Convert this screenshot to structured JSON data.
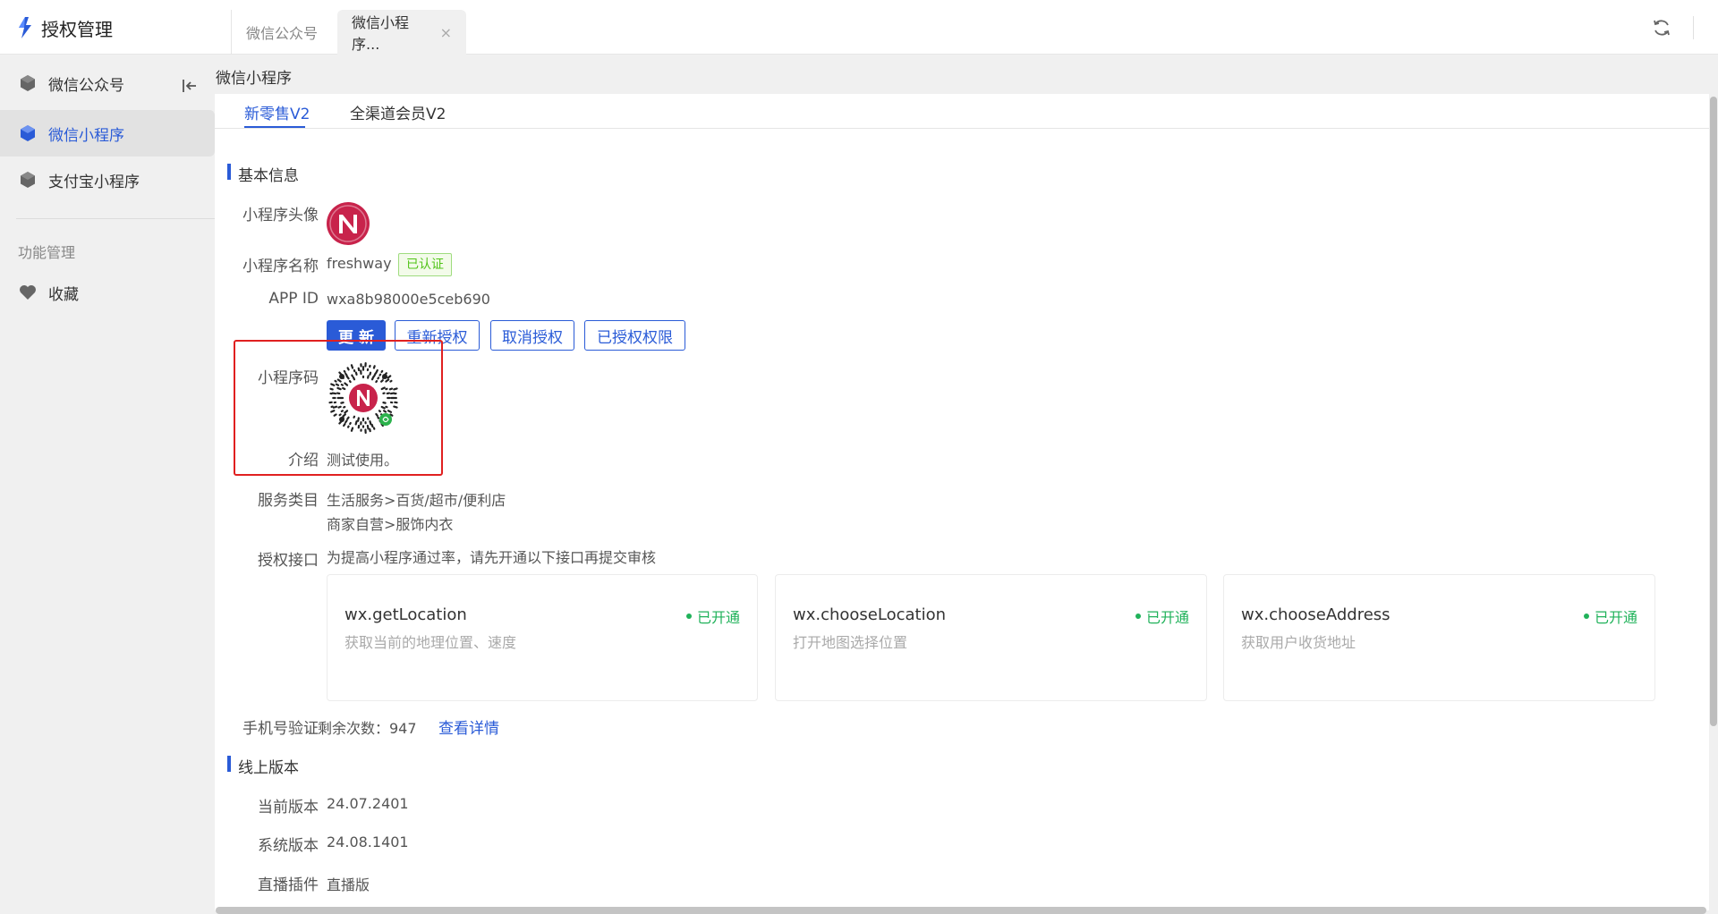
{
  "app": {
    "title": "授权管理",
    "brand_color": "#2a5bd7"
  },
  "top_tabs": [
    {
      "label": "微信公众号",
      "active": false
    },
    {
      "label": "微信小程序...",
      "active": true,
      "close": "×"
    }
  ],
  "sidebar": {
    "items": [
      {
        "label": "微信公众号"
      },
      {
        "label": "微信小程序"
      },
      {
        "label": "支付宝小程序"
      }
    ],
    "group_label": "功能管理",
    "favorites_label": "收藏"
  },
  "breadcrumb": "微信小程序",
  "sub_tabs": [
    {
      "label": "新零售V2",
      "active": true
    },
    {
      "label": "全渠道会员V2",
      "active": false
    }
  ],
  "basic_info": {
    "title": "基本信息",
    "avatar_label": "小程序头像",
    "name_label": "小程序名称",
    "name_value": "freshway",
    "verified_badge": "已认证",
    "appid_label": "APP ID",
    "appid_value": "wxa8b98000e5ceb690",
    "buttons": {
      "refresh": "更 新",
      "reauthorize": "重新授权",
      "cancel_auth": "取消授权",
      "authorized_perms": "已授权权限"
    },
    "qrcode_label": "小程序码",
    "intro_label": "介绍",
    "intro_value": "测试使用。",
    "category_label": "服务类目",
    "category_values": [
      "生活服务>百货/超市/便利店",
      "商家自营>服饰内衣"
    ],
    "api_label": "授权接口",
    "api_hint": "为提高小程序通过率，请先开通以下接口再提交审核",
    "apis": [
      {
        "name": "wx.getLocation",
        "desc": "获取当前的地理位置、速度",
        "status": "已开通"
      },
      {
        "name": "wx.chooseLocation",
        "desc": "打开地图选择位置",
        "status": "已开通"
      },
      {
        "name": "wx.chooseAddress",
        "desc": "获取用户收货地址",
        "status": "已开通"
      }
    ],
    "phone_label": "手机号验证",
    "phone_value": "剩余次数：947",
    "phone_link": "查看详情"
  },
  "online_version": {
    "title": "线上版本",
    "current_label": "当前版本",
    "current_value": "24.07.2401",
    "system_label": "系统版本",
    "system_value": "24.08.1401",
    "live_label": "直播插件",
    "live_value": "直播版"
  },
  "colors": {
    "success": "#20b25a",
    "highlight": "#e02020",
    "badge_green": "#52c41a"
  }
}
